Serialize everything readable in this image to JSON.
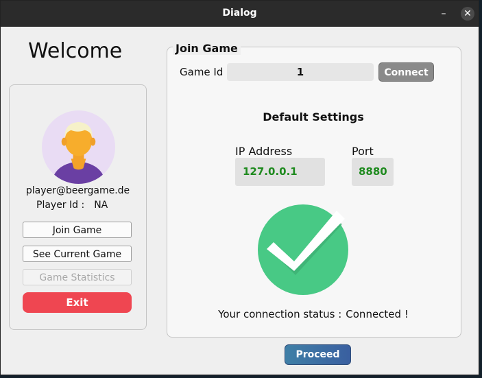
{
  "window": {
    "title": "Dialog",
    "minimize_symbol": "–",
    "close_symbol": "✕"
  },
  "sidebar": {
    "welcome": "Welcome",
    "email": "player@beergame.de",
    "player_id_label": "Player Id :",
    "player_id_value": "NA",
    "buttons": {
      "join_game": "Join Game",
      "see_current_game": "See Current Game",
      "game_statistics": "Game Statistics",
      "exit": "Exit"
    }
  },
  "join_game": {
    "group_title": "Join Game",
    "game_id_label": "Game Id",
    "game_id_value": "1",
    "connect_label": "Connect",
    "default_settings_title": "Default Settings",
    "ip_label": "IP Address",
    "ip_value": "127.0.0.1",
    "port_label": "Port",
    "port_value": "8880",
    "status_label": "Your connection status :",
    "status_value": "Connected !",
    "status_icon": "check-circle-icon"
  },
  "footer": {
    "proceed_label": "Proceed"
  },
  "colors": {
    "exit_button": "#ef4651",
    "check_green": "#48c985",
    "value_green": "#1e8a1e",
    "connect_button": "#8a8a8a",
    "proceed_button": "#3f7fa6"
  }
}
